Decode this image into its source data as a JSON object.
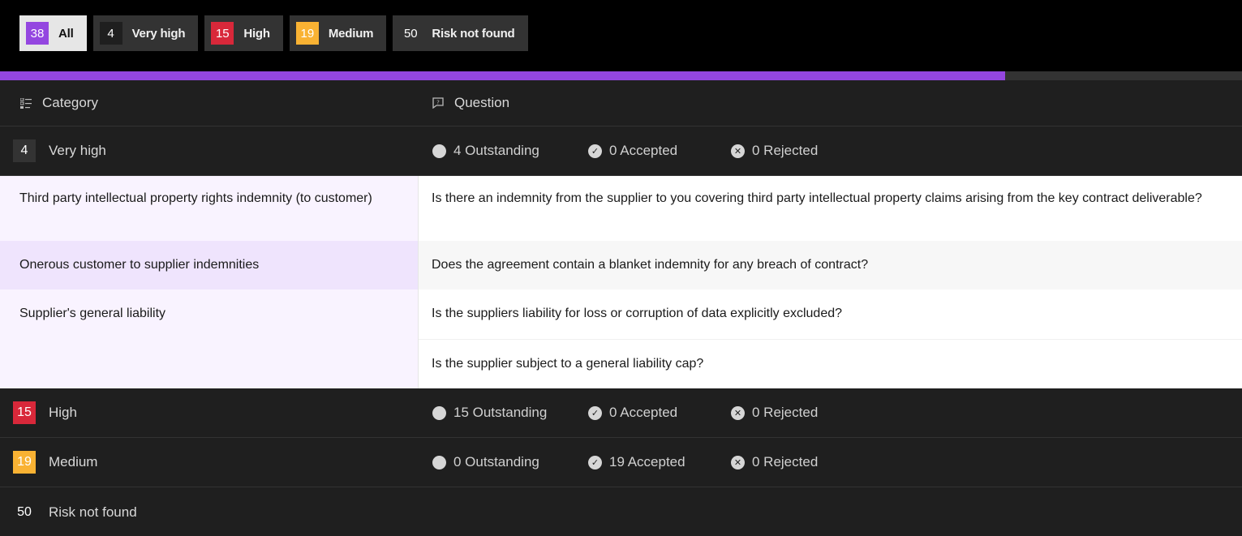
{
  "filters": [
    {
      "count": "38",
      "label": "All",
      "color": "#9446e0",
      "active": true
    },
    {
      "count": "4",
      "label": "Very high",
      "color": "#1f1f1f",
      "active": false
    },
    {
      "count": "15",
      "label": "High",
      "color": "#d8283a",
      "active": false
    },
    {
      "count": "19",
      "label": "Medium",
      "color": "#f9b233",
      "active": false
    },
    {
      "count": "50",
      "label": "Risk not found",
      "color": "#333333",
      "active": false
    }
  ],
  "progress": {
    "percent": 80.9,
    "color": "#9446e0"
  },
  "table": {
    "headers": {
      "category": "Category",
      "question": "Question",
      "category_icon": "list-icon",
      "question_icon": "question-message-icon"
    },
    "groups": [
      {
        "count": "4",
        "name": "Very high",
        "color": "#333333",
        "outstanding": "4 Outstanding",
        "accepted": "0 Accepted",
        "rejected": "0 Rejected",
        "expanded": true,
        "rows": [
          {
            "category": "Third party intellectual property rights indemnity (to customer)",
            "questions": [
              "Is there an indemnity from the supplier to you covering third party intellectual property claims arising from the key contract deliverable?"
            ]
          },
          {
            "category": "Onerous customer to supplier indemnities",
            "questions": [
              "Does the agreement contain a blanket indemnity for any breach of contract?"
            ]
          },
          {
            "category": "Supplier's general liability",
            "questions": [
              "Is the suppliers liability for loss or corruption of data explicitly excluded?",
              "Is the supplier subject to a general liability cap?"
            ]
          }
        ]
      },
      {
        "count": "15",
        "name": "High",
        "color": "#d8283a",
        "outstanding": "15 Outstanding",
        "accepted": "0 Accepted",
        "rejected": "0 Rejected",
        "expanded": false
      },
      {
        "count": "19",
        "name": "Medium",
        "color": "#f9b233",
        "outstanding": "0 Outstanding",
        "accepted": "19 Accepted",
        "rejected": "0 Rejected",
        "expanded": false
      },
      {
        "count": "50",
        "name": "Risk not found",
        "color": "#1f1f1f",
        "expanded": false
      }
    ]
  }
}
